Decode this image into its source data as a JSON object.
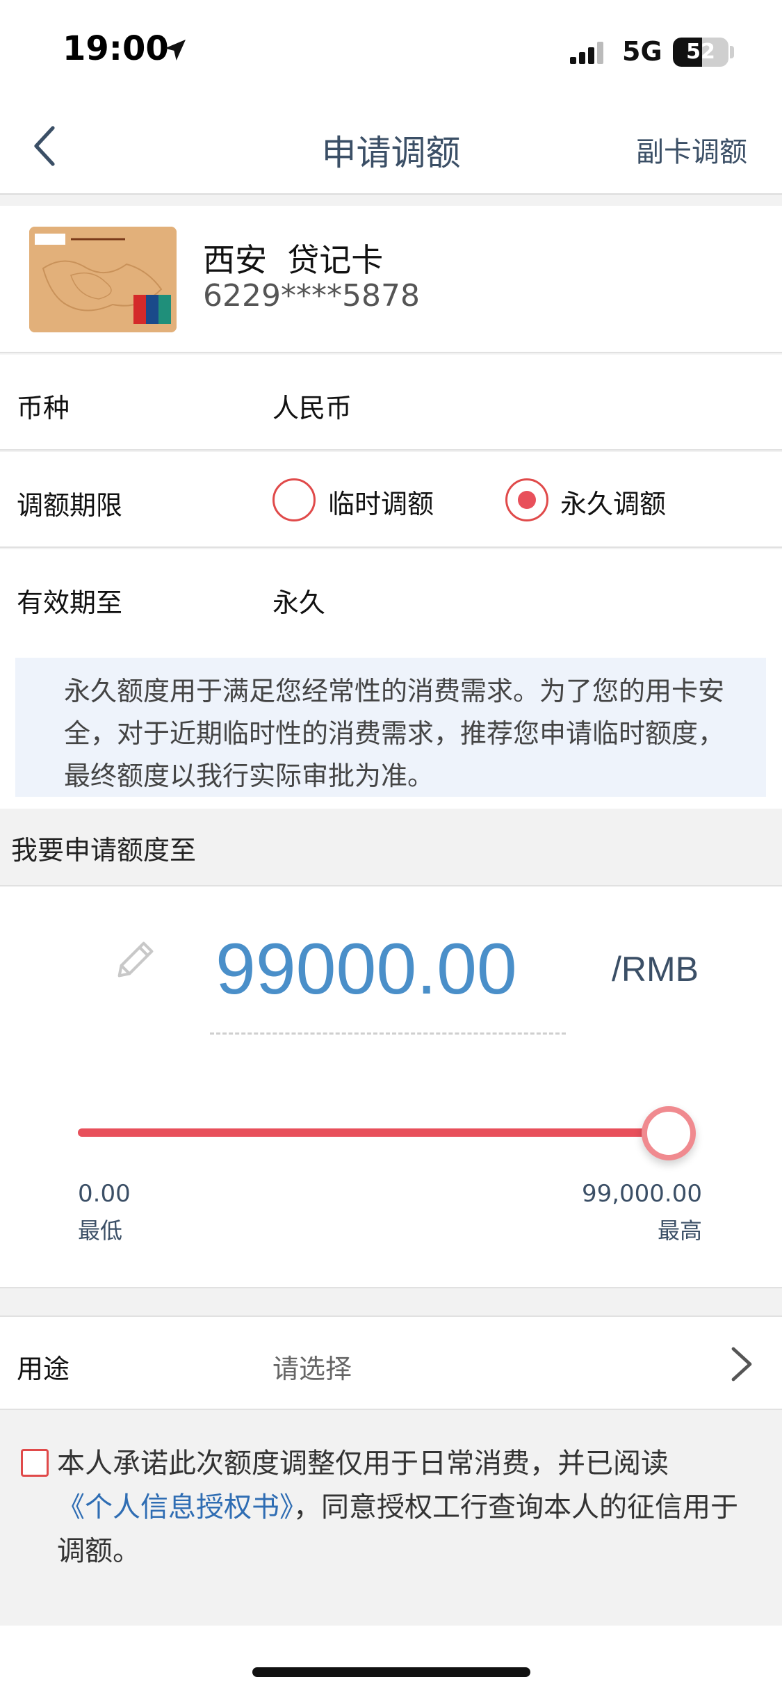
{
  "status": {
    "time": "19:00",
    "network": "5G",
    "battery": "52",
    "battery_level": 0.52
  },
  "header": {
    "title": "申请调额",
    "right_action": "副卡调额"
  },
  "card": {
    "name": "西安  贷记卡",
    "number": "6229****5878"
  },
  "currency": {
    "label": "币种",
    "value": "人民币"
  },
  "term": {
    "label": "调额期限",
    "options": [
      {
        "label": "临时调额",
        "selected": false
      },
      {
        "label": "永久调额",
        "selected": true
      }
    ]
  },
  "expiry": {
    "label": "有效期至",
    "value": "永久"
  },
  "notice": "永久额度用于满足您经常性的消费需求。为了您的用卡安全，对于近期临时性的消费需求，推荐您申请临时额度，最终额度以我行实际审批为准。",
  "amount_section": {
    "title": "我要申请额度至",
    "value": "99000.00",
    "unit": "/RMB",
    "min_value": "0.00",
    "min_label": "最低",
    "max_value": "99,000.00",
    "max_label": "最高",
    "slider_fraction": 1.0
  },
  "purpose": {
    "label": "用途",
    "placeholder": "请选择"
  },
  "agreement": {
    "text_before": "本人承诺此次额度调整仅用于日常消费，并已阅读",
    "link": "《个人信息授权书》",
    "text_after": "，同意授权工行查询本人的征信用于调额。",
    "checked": false
  },
  "colors": {
    "accent_red": "#e8505b",
    "amount_blue": "#4a8fc9",
    "link_blue": "#2f6db3",
    "title_slate": "#3b4f66"
  },
  "icons": {
    "back": "chevron-left-icon",
    "edit": "pencil-icon",
    "purpose_arrow": "chevron-right-icon"
  }
}
